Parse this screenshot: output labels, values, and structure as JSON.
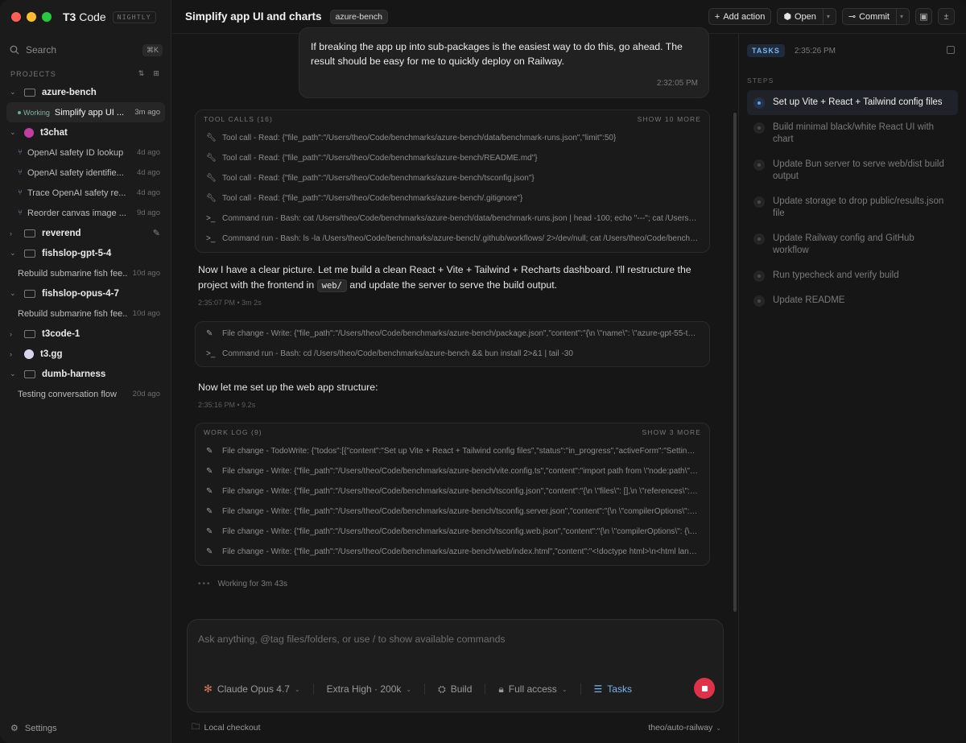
{
  "app": {
    "name_bold": "T3",
    "name_rest": " Code",
    "badge": "NIGHTLY"
  },
  "sidebar": {
    "search_label": "Search",
    "search_shortcut": "⌘K",
    "projects_label": "PROJECTS",
    "projects": [
      {
        "name": "azure-bench",
        "expanded": true,
        "threads": [
          {
            "title": "Simplify app UI ...",
            "age": "3m ago",
            "status": "Working",
            "active": true
          }
        ]
      },
      {
        "name": "t3chat",
        "expanded": true,
        "threads": [
          {
            "title": "OpenAI safety ID lookup",
            "age": "4d ago"
          },
          {
            "title": "OpenAI safety identifie...",
            "age": "4d ago"
          },
          {
            "title": "Trace OpenAI safety re...",
            "age": "4d ago"
          },
          {
            "title": "Reorder canvas image ...",
            "age": "9d ago"
          }
        ]
      },
      {
        "name": "reverend",
        "expanded": false
      },
      {
        "name": "fishslop-gpt-5-4",
        "expanded": true,
        "threads": [
          {
            "title": "Rebuild submarine fish fee...",
            "age": "10d ago"
          }
        ]
      },
      {
        "name": "fishslop-opus-4-7",
        "expanded": true,
        "threads": [
          {
            "title": "Rebuild submarine fish fee...",
            "age": "10d ago"
          }
        ]
      },
      {
        "name": "t3code-1",
        "expanded": false
      },
      {
        "name": "t3.gg",
        "expanded": false
      },
      {
        "name": "dumb-harness",
        "expanded": true,
        "threads": [
          {
            "title": "Testing conversation flow",
            "age": "20d ago"
          }
        ]
      }
    ],
    "settings_label": "Settings"
  },
  "topbar": {
    "title": "Simplify app UI and charts",
    "repo": "azure-bench",
    "add_action": "Add action",
    "open": "Open",
    "commit": "Commit"
  },
  "chat": {
    "user_message": "If breaking the app up into sub-packages is the easiest way to do this, go ahead. The result should be easy for me to quickly deploy on Railway.",
    "user_time": "2:32:05 PM",
    "tool_calls": {
      "label": "TOOL CALLS (16)",
      "more": "SHOW 10 MORE",
      "rows": [
        "Tool call - Read: {\"file_path\":\"/Users/theo/Code/benchmarks/azure-bench/data/benchmark-runs.json\",\"limit\":50}",
        "Tool call - Read: {\"file_path\":\"/Users/theo/Code/benchmarks/azure-bench/README.md\"}",
        "Tool call - Read: {\"file_path\":\"/Users/theo/Code/benchmarks/azure-bench/tsconfig.json\"}",
        "Tool call - Read: {\"file_path\":\"/Users/theo/Code/benchmarks/azure-bench/.gitignore\"}",
        "Command run - Bash: cat /Users/theo/Code/benchmarks/azure-bench/data/benchmark-runs.json | head -100; echo \"---\"; cat /Users/the...",
        "Command run - Bash: ls -la /Users/theo/Code/benchmarks/azure-bench/.github/workflows/ 2>/dev/null; cat /Users/theo/Code/benchmar..."
      ]
    },
    "assistant_1_a": "Now I have a clear picture. Let me build a clean React + Vite + Tailwind + Recharts dashboard. I'll restructure the project with the frontend in ",
    "assistant_1_code": "web/",
    "assistant_1_b": " and update the server to serve the build output.",
    "meta_1": "2:35:07 PM • 3m 2s",
    "changes_1": [
      "File change - Write: {\"file_path\":\"/Users/theo/Code/benchmarks/azure-bench/package.json\",\"content\":\"{\\n  \\\"name\\\": \\\"azure-gpt-55-tps-be...",
      "Command run - Bash: cd /Users/theo/Code/benchmarks/azure-bench && bun install 2>&1 | tail -30"
    ],
    "assistant_2": "Now let me set up the web app structure:",
    "meta_2": "2:35:16 PM • 9.2s",
    "work_log": {
      "label": "WORK LOG (9)",
      "more": "SHOW 3 MORE",
      "rows": [
        "File change - TodoWrite: {\"todos\":[{\"content\":\"Set up Vite + React + Tailwind config files\",\"status\":\"in_progress\",\"activeForm\":\"Setting up Vite ...",
        "File change - Write: {\"file_path\":\"/Users/theo/Code/benchmarks/azure-bench/vite.config.ts\",\"content\":\"import path from \\\"node:path\\\";\\nim...",
        "File change - Write: {\"file_path\":\"/Users/theo/Code/benchmarks/azure-bench/tsconfig.json\",\"content\":\"{\\n  \\\"files\\\": [],\\n  \\\"references\\\": [\\n    { \\\"...",
        "File change - Write: {\"file_path\":\"/Users/theo/Code/benchmarks/azure-bench/tsconfig.server.json\",\"content\":\"{\\n  \\\"compilerOptions\\\": {\\n    \\\"c...",
        "File change - Write: {\"file_path\":\"/Users/theo/Code/benchmarks/azure-bench/tsconfig.web.json\",\"content\":\"{\\n  \\\"compilerOptions\\\": {\\n    \\\"co...",
        "File change - Write: {\"file_path\":\"/Users/theo/Code/benchmarks/azure-bench/web/index.html\",\"content\":\"<!doctype html>\\n<html lang=\\\"en..."
      ]
    },
    "working": "Working for 3m 43s"
  },
  "composer": {
    "placeholder": "Ask anything, @tag files/folders, or use / to show available commands",
    "model": "Claude Opus 4.7",
    "effort": "Extra High · 200k",
    "mode": "Build",
    "access": "Full access",
    "tasks": "Tasks"
  },
  "footer": {
    "checkout": "Local checkout",
    "branch": "theo/auto-railway"
  },
  "tasks_panel": {
    "label": "TASKS",
    "time": "2:35:26 PM",
    "steps_label": "STEPS",
    "steps": [
      {
        "text": "Set up Vite + React + Tailwind config files",
        "active": true
      },
      {
        "text": "Build minimal black/white React UI with chart"
      },
      {
        "text": "Update Bun server to serve web/dist build output"
      },
      {
        "text": "Update storage to drop public/results.json file"
      },
      {
        "text": "Update Railway config and GitHub workflow"
      },
      {
        "text": "Run typecheck and verify build"
      },
      {
        "text": "Update README"
      }
    ]
  },
  "colors": {
    "accent": "#7bb4f2",
    "stop": "#e0314b",
    "working": "#5fb38f"
  }
}
